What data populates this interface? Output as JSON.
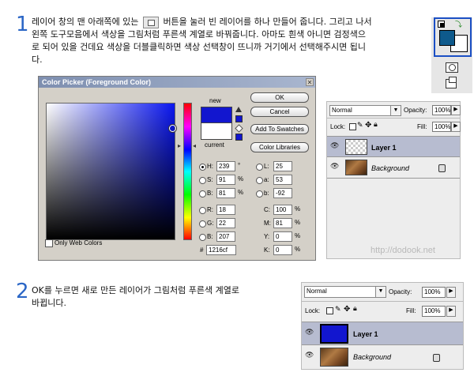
{
  "step1": {
    "number": "1",
    "line1_before": "레이어 창의 맨 아래쪽에 있는",
    "line1_after": "버튼을 눌러 빈 레이어를 하나 만들어 줍니다. 그리고 나서",
    "line2": "왼쪽 도구모음에서 색상을 그림처럼 푸른색 계열로 바꿔줍니다. 아마도 흰색 아니면 검정색으",
    "line3": "로 되어 있을 건데요 색상을 더블클릭하면 색상 선택창이 뜨니까 거기에서 선택해주시면 됩니",
    "line4": "다."
  },
  "step2": {
    "number": "2",
    "line1": "OK를 누르면 새로 만든 레이어가 그림처럼 푸른색 계열로",
    "line2": "바뀝니다."
  },
  "color_picker": {
    "title": "Color Picker (Foreground Color)",
    "close": "✕",
    "new_label": "new",
    "current_label": "current",
    "new_color": "#1216cf",
    "current_color": "#ffffff",
    "buttons": {
      "ok": "OK",
      "cancel": "Cancel",
      "add_swatches": "Add To Swatches",
      "color_libraries": "Color Libraries"
    },
    "fields": {
      "h": {
        "label": "H:",
        "value": "239",
        "unit": "°"
      },
      "s": {
        "label": "S:",
        "value": "91",
        "unit": "%"
      },
      "b": {
        "label": "B:",
        "value": "81",
        "unit": "%"
      },
      "r": {
        "label": "R:",
        "value": "18"
      },
      "g": {
        "label": "G:",
        "value": "22"
      },
      "bb": {
        "label": "B:",
        "value": "207"
      },
      "l": {
        "label": "L:",
        "value": "25"
      },
      "a": {
        "label": "a:",
        "value": "53"
      },
      "lab_b": {
        "label": "b:",
        "value": "-92"
      },
      "c": {
        "label": "C:",
        "value": "100",
        "unit": "%"
      },
      "m": {
        "label": "M:",
        "value": "81",
        "unit": "%"
      },
      "y": {
        "label": "Y:",
        "value": "0",
        "unit": "%"
      },
      "k": {
        "label": "K:",
        "value": "0",
        "unit": "%"
      },
      "hex_label": "#",
      "hex": "1216cf"
    },
    "only_web_colors": "Only Web Colors"
  },
  "layers_panel_1": {
    "blend_mode": "Normal",
    "opacity_label": "Opacity:",
    "opacity_value": "100%",
    "lock_label": "Lock:",
    "fill_label": "Fill:",
    "fill_value": "100%",
    "layers": [
      {
        "name": "Layer 1"
      },
      {
        "name": "Background"
      }
    ],
    "watermark": "http://dodook.net"
  },
  "layers_panel_2": {
    "blend_mode": "Normal",
    "opacity_label": "Opacity:",
    "opacity_value": "100%",
    "lock_label": "Lock:",
    "fill_label": "Fill:",
    "fill_value": "100%",
    "layers": [
      {
        "name": "Layer 1",
        "fill": "#1216cf"
      },
      {
        "name": "Background"
      }
    ]
  },
  "toolbox": {
    "foreground": "#0e5a8c",
    "background": "#ffffff"
  }
}
